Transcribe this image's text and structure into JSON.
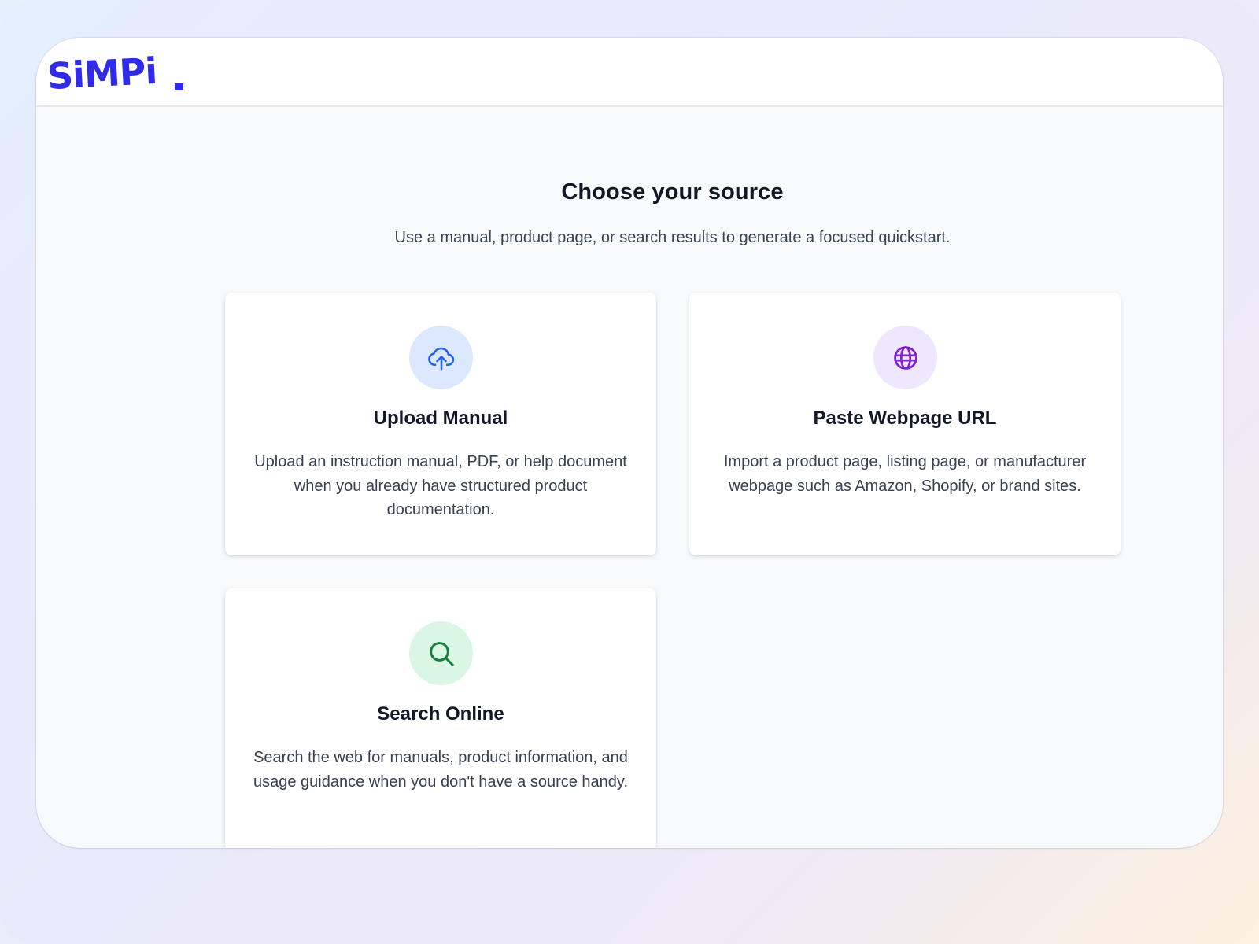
{
  "header": {
    "logo_text": "SiMPi",
    "brand_color": "#2f2be8"
  },
  "main": {
    "title": "Choose your source",
    "subtitle": "Use a manual, product page, or search results to generate a focused quickstart."
  },
  "options": [
    {
      "title": "Upload Manual",
      "description": "Upload an instruction manual, PDF, or help document when you already have structured product documentation.",
      "icon": "cloud-upload-icon",
      "icon_color": "#2563eb",
      "icon_bg": "#dbe8fd"
    },
    {
      "title": "Paste Webpage URL",
      "description": "Import a product page, listing page, or manufacturer webpage such as Amazon, Shopify, or brand sites.",
      "icon": "globe-icon",
      "icon_color": "#7e22ce",
      "icon_bg": "#efe7fd"
    },
    {
      "title": "Search Online",
      "description": "Search the web for manuals, product information, and usage guidance when you don't have a source handy.",
      "icon": "search-icon",
      "icon_color": "#15803d",
      "icon_bg": "#d9f7e3"
    }
  ]
}
